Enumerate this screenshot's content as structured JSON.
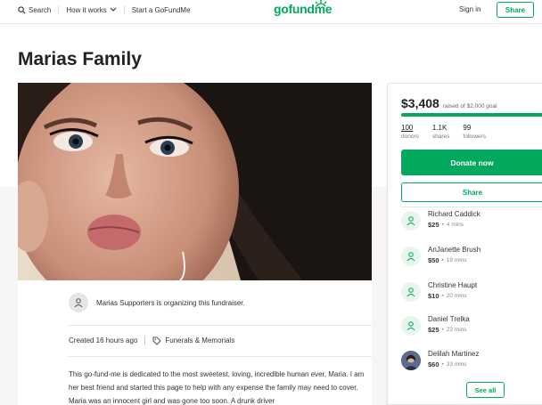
{
  "header": {
    "search_label": "Search",
    "how_it_works_label": "How it works",
    "start_label": "Start a GoFundMe",
    "logo_text": "gofundme",
    "signin_label": "Sign in",
    "share_label": "Share"
  },
  "campaign": {
    "title": "Marias Family",
    "organizer_text": "Marias Supporters is organizing this fundraiser.",
    "created_text": "Created 16 hours ago",
    "category": "Funerals & Memorials",
    "story": "This go-fund-me is dedicated to the most sweetest, loving, incredible human ever, Maria. I am her best friend and started this page to help with any expense the family may need to cover. Maria was an innocent girl and was gone too soon. A drunk driver"
  },
  "sidebar": {
    "raised_amount": "$3,408",
    "raised_goal": "raised of $2,000 goal",
    "progress_fraction": 1.0,
    "stats": [
      {
        "num": "100",
        "label": "donors"
      },
      {
        "num": "1.1K",
        "label": "shares"
      },
      {
        "num": "99",
        "label": "followers"
      }
    ],
    "donate_label": "Donate now",
    "share_label": "Share",
    "donors": [
      {
        "name": "Richard Caddick",
        "amount": "$25",
        "time": "4 mins"
      },
      {
        "name": "AnJanette Brush",
        "amount": "$50",
        "time": "19 mins"
      },
      {
        "name": "Christine Haupt",
        "amount": "$10",
        "time": "20 mins"
      },
      {
        "name": "Daniel Trelka",
        "amount": "$25",
        "time": "23 mins"
      },
      {
        "name": "Delilah Martinez",
        "amount": "$60",
        "time": "33 mins"
      }
    ],
    "see_all_label": "See all"
  },
  "colors": {
    "accent": "#02a95c",
    "band": "#f7f6f5"
  }
}
